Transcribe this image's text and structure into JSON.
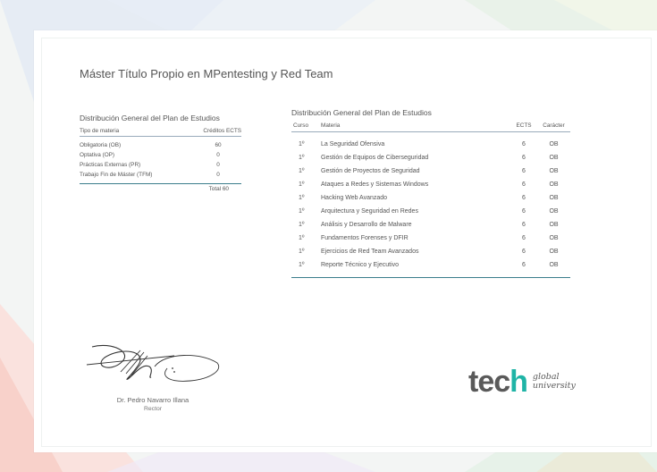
{
  "title": "Máster Título Propio en MPentesting y Red Team",
  "distribution": {
    "heading": "Distribución General del Plan de Estudios",
    "col_type": "Tipo de materia",
    "col_credits": "Créditos ECTS",
    "rows": [
      {
        "name": "Obligatoria (OB)",
        "value": "60"
      },
      {
        "name": "Optativa (OP)",
        "value": "0"
      },
      {
        "name": "Prácticas Externas (PR)",
        "value": "0"
      },
      {
        "name": "Trabajo Fin de Máster (TFM)",
        "value": "0"
      }
    ],
    "total": "Total 60"
  },
  "plan": {
    "heading": "Distribución General del Plan de Estudios",
    "col_course": "Curso",
    "col_subject": "Materia",
    "col_ects": "ECTS",
    "col_type": "Carácter",
    "rows": [
      {
        "course": "1º",
        "subject": "La Seguridad Ofensiva",
        "ects": "6",
        "type": "OB"
      },
      {
        "course": "1º",
        "subject": "Gestión de Equipos de Ciberseguridad",
        "ects": "6",
        "type": "OB"
      },
      {
        "course": "1º",
        "subject": "Gestión de Proyectos de Seguridad",
        "ects": "6",
        "type": "OB"
      },
      {
        "course": "1º",
        "subject": "Ataques a Redes y Sistemas Windows",
        "ects": "6",
        "type": "OB"
      },
      {
        "course": "1º",
        "subject": "Hacking Web Avanzado",
        "ects": "6",
        "type": "OB"
      },
      {
        "course": "1º",
        "subject": "Arquitectura y Seguridad en Redes",
        "ects": "6",
        "type": "OB"
      },
      {
        "course": "1º",
        "subject": "Análisis y Desarrollo de Malware",
        "ects": "6",
        "type": "OB"
      },
      {
        "course": "1º",
        "subject": "Fundamentos Forenses y DFIR",
        "ects": "6",
        "type": "OB"
      },
      {
        "course": "1º",
        "subject": "Ejercicios de Red Team Avanzados",
        "ects": "6",
        "type": "OB"
      },
      {
        "course": "1º",
        "subject": "Reporte Técnico y Ejecutivo",
        "ects": "6",
        "type": "OB"
      }
    ]
  },
  "signature": {
    "name": "Dr. Pedro Navarro Illana",
    "role": "Rector"
  },
  "logo": {
    "mark_a": "tec",
    "mark_b": "h",
    "line1": "global",
    "line2": "university"
  },
  "colors": {
    "accent": "#1fb4a6",
    "rule": "#3b7d8c"
  }
}
